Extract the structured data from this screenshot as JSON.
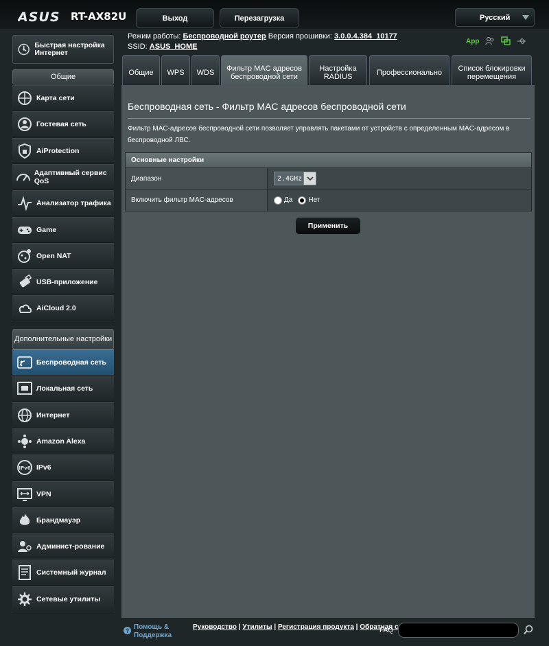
{
  "header": {
    "model": "RT-AX82U",
    "logout_label": "Выход",
    "reboot_label": "Перезагрузка",
    "language": "Русский"
  },
  "status": {
    "mode_label": "Режим работы:",
    "mode_value": "Беспроводной роутер",
    "firmware_label": "Версия прошивки:",
    "firmware_value": "3.0.0.4.384_10177",
    "ssid_label": "SSID:",
    "ssid_value": "ASUS_HOME",
    "app_label": "App"
  },
  "sidebar": {
    "quick_setup": "Быстрая настройка Интернет",
    "general_header": "Общие",
    "general_items": [
      {
        "label": "Карта сети",
        "icon": "network-map-icon"
      },
      {
        "label": "Гостевая сеть",
        "icon": "guest-network-icon"
      },
      {
        "label": "AiProtection",
        "icon": "aiprotection-icon"
      },
      {
        "label": "Адаптивный сервис QoS",
        "icon": "qos-icon"
      },
      {
        "label": "Анализатор трафика",
        "icon": "traffic-analyzer-icon"
      },
      {
        "label": "Game",
        "icon": "gamepad-icon"
      },
      {
        "label": "Open NAT",
        "icon": "open-nat-icon"
      },
      {
        "label": "USB-приложение",
        "icon": "usb-icon"
      },
      {
        "label": "AiCloud 2.0",
        "icon": "cloud-icon"
      }
    ],
    "advanced_header": "Дополнительные настройки",
    "advanced_items": [
      {
        "label": "Беспроводная сеть",
        "icon": "wireless-icon",
        "active": true
      },
      {
        "label": "Локальная сеть",
        "icon": "lan-icon"
      },
      {
        "label": "Интернет",
        "icon": "globe-icon"
      },
      {
        "label": "Amazon Alexa",
        "icon": "alexa-icon"
      },
      {
        "label": "IPv6",
        "icon": "ipv6-icon"
      },
      {
        "label": "VPN",
        "icon": "vpn-icon"
      },
      {
        "label": "Брандмауэр",
        "icon": "firewall-icon"
      },
      {
        "label": "Админист-рование",
        "icon": "admin-icon"
      },
      {
        "label": "Системный журнал",
        "icon": "system-log-icon"
      },
      {
        "label": "Сетевые утилиты",
        "icon": "network-tools-icon"
      }
    ]
  },
  "tabs": [
    {
      "label": "Общие"
    },
    {
      "label": "WPS"
    },
    {
      "label": "WDS"
    },
    {
      "label": "Фильтр MAC адресов беспроводной сети",
      "active": true
    },
    {
      "label": "Настройка RADIUS"
    },
    {
      "label": "Профессионально"
    },
    {
      "label": "Список блокировки перемещения"
    }
  ],
  "main": {
    "title": "Беспроводная сеть - Фильтр MAC адресов беспроводной сети",
    "description": "Фильтр MAC-адресов беспроводной сети позволяет управлять пакетами от устройств с определенным MAC-адресом в беспроводной ЛВС.",
    "section_header": "Основные настройки",
    "band_label": "Диапазон",
    "band_value": "2.4GHz",
    "filter_label": "Включить фильтр MAC-адресов",
    "radio_yes": "Да",
    "radio_no": "Нет",
    "filter_enabled": false,
    "apply_label": "Применить"
  },
  "footer": {
    "help_label": "Помощь & Поддержка",
    "link_manual": "Руководство",
    "link_utility": "Утилиты",
    "link_register": "Регистрация продукта",
    "link_feedback": "Обратная связь",
    "faq_label": "FAQ"
  },
  "colors": {
    "accent_active": "#2e5f82",
    "panel_bg": "#4d5759",
    "app_green": "#58d13a",
    "help_blue": "#6aa6cf"
  }
}
